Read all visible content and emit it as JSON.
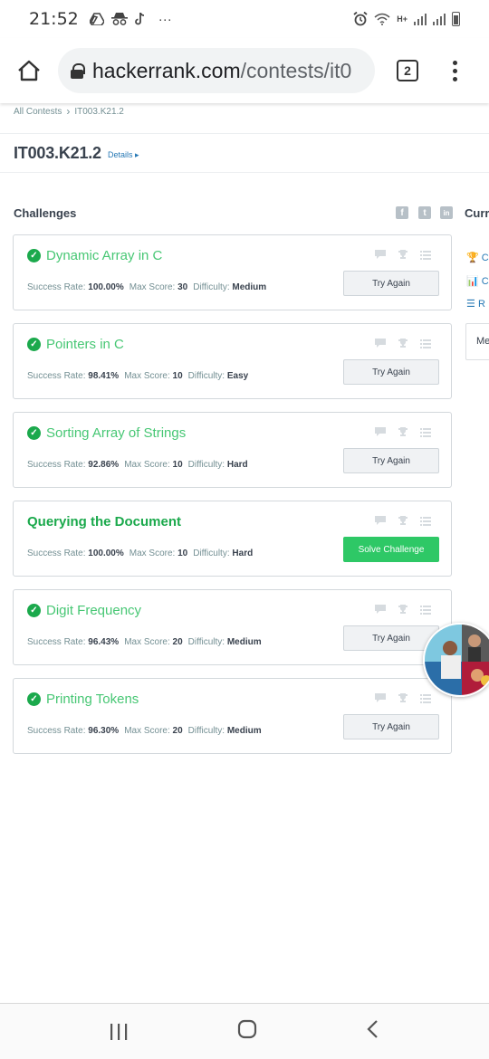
{
  "status_bar": {
    "time": "21:52",
    "network_label": "H+",
    "notification_more": "···"
  },
  "browser": {
    "url_main": "hackerrank.com",
    "url_rest": "/contests/it0",
    "tab_count": "2"
  },
  "breadcrumb": {
    "root": "All Contests",
    "separator": "›",
    "current": "IT003.K21.2"
  },
  "contest": {
    "title": "IT003.K21.2",
    "details_label": "Details ▸"
  },
  "challenges_heading": "Challenges",
  "social": [
    "f",
    "t",
    "in"
  ],
  "sidebar": {
    "heading": "Curr",
    "links": [
      "C",
      "C",
      "R"
    ],
    "box_text": "Me"
  },
  "meta_labels": {
    "success_rate": "Success Rate:",
    "max_score": "Max Score:",
    "difficulty": "Difficulty:"
  },
  "challenges": [
    {
      "name": "Dynamic Array in C",
      "solved": true,
      "success_rate": "100.00%",
      "max_score": "30",
      "difficulty": "Medium",
      "action": "Try Again"
    },
    {
      "name": "Pointers in C",
      "solved": true,
      "success_rate": "98.41%",
      "max_score": "10",
      "difficulty": "Easy",
      "action": "Try Again"
    },
    {
      "name": "Sorting Array of Strings",
      "solved": true,
      "success_rate": "92.86%",
      "max_score": "10",
      "difficulty": "Hard",
      "action": "Try Again"
    },
    {
      "name": "Querying the Document",
      "solved": false,
      "success_rate": "100.00%",
      "max_score": "10",
      "difficulty": "Hard",
      "action": "Solve Challenge"
    },
    {
      "name": "Digit Frequency",
      "solved": true,
      "success_rate": "96.43%",
      "max_score": "20",
      "difficulty": "Medium",
      "action": "Try Again"
    },
    {
      "name": "Printing Tokens",
      "solved": true,
      "success_rate": "96.30%",
      "max_score": "20",
      "difficulty": "Medium",
      "action": "Try Again"
    }
  ],
  "colors": {
    "accent_green": "#1ba94c",
    "solved_title": "#47c774",
    "primary_button": "#2ec866",
    "link_blue": "#2779b5"
  },
  "icons": {
    "check": "check-circle-icon",
    "discuss": "speech-bubble-icon",
    "leaderboard": "trophy-icon",
    "submissions": "list-icon"
  }
}
